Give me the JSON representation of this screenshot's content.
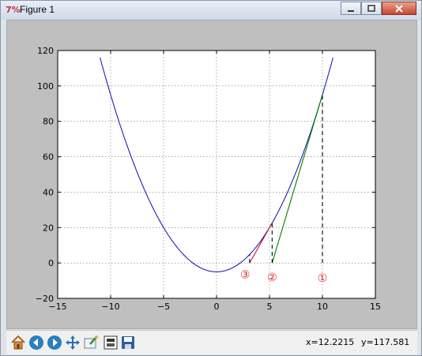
{
  "window": {
    "title": "Figure 1",
    "app_icon_glyph": "7%"
  },
  "toolbar": {
    "buttons": [
      {
        "name": "home-icon"
      },
      {
        "name": "back-arrow-icon"
      },
      {
        "name": "forward-arrow-icon"
      },
      {
        "name": "pan-icon"
      },
      {
        "name": "zoom-rect-icon"
      },
      {
        "name": "configure-subplots-icon"
      },
      {
        "name": "save-icon"
      }
    ],
    "coords": {
      "x": "x=12.2215",
      "y": "y=117.581"
    }
  },
  "chart_data": {
    "type": "line",
    "title": "",
    "xlabel": "",
    "ylabel": "",
    "xlim": [
      -15,
      15
    ],
    "ylim": [
      -20,
      120
    ],
    "xticks": [
      "−15",
      "−10",
      "−5",
      "0",
      "5",
      "10",
      "15"
    ],
    "yticks": [
      "−20",
      "0",
      "20",
      "40",
      "60",
      "80",
      "100",
      "120"
    ],
    "grid": true,
    "series": [
      {
        "kind": "curve",
        "expression": "y = x^2 - 5",
        "x_range": [
          -11,
          11
        ],
        "color": "#1f1fb4"
      },
      {
        "kind": "segment",
        "x": [
          5.25,
          10
        ],
        "y": [
          0,
          95
        ],
        "color": "#008000"
      },
      {
        "kind": "segment",
        "x": [
          3.125,
          5.25
        ],
        "y": [
          0,
          22.5625
        ],
        "color": "#d01030"
      },
      {
        "kind": "dashed",
        "x": [
          10,
          10
        ],
        "y": [
          0,
          95
        ],
        "color": "#000000"
      },
      {
        "kind": "dashed",
        "x": [
          5.25,
          5.25
        ],
        "y": [
          0,
          22.5625
        ],
        "color": "#000000"
      },
      {
        "kind": "dashed",
        "x": [
          3.125,
          3.125
        ],
        "y": [
          0,
          4.77
        ],
        "color": "#000000"
      }
    ],
    "annotations": [
      {
        "text": "①",
        "x": 10,
        "y": -8.5,
        "color": "#e02020"
      },
      {
        "text": "②",
        "x": 5.25,
        "y": -8,
        "color": "#e02020"
      },
      {
        "text": "③",
        "x": 2.7,
        "y": -6.5,
        "color": "#e02020"
      }
    ]
  }
}
